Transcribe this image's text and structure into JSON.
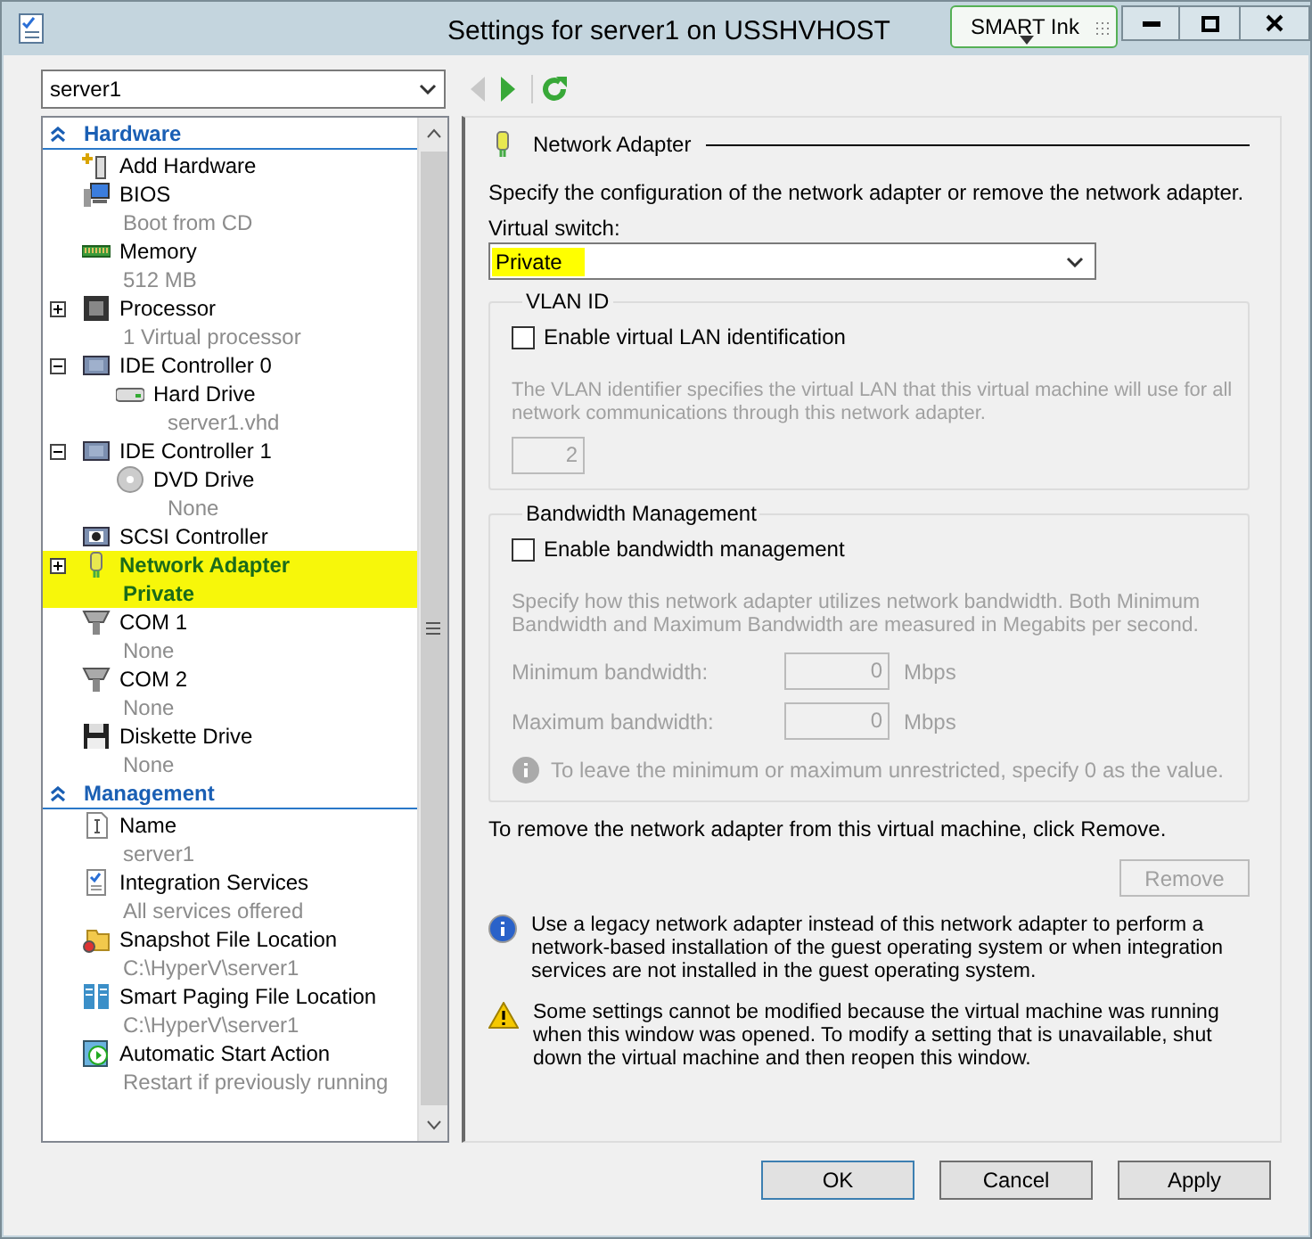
{
  "window": {
    "title": "Settings for server1 on USSHVHOST",
    "smart_ink": "SMART Ink"
  },
  "vm_selector": {
    "value": "server1"
  },
  "nav": [
    {
      "kind": "back",
      "disabled": true
    },
    {
      "kind": "forward",
      "disabled": false
    },
    {
      "kind": "refresh",
      "disabled": false
    }
  ],
  "tree": [
    {
      "title": "Hardware",
      "expanded": true,
      "items": [
        {
          "kind": "add",
          "label": "Add Hardware",
          "selected": false
        },
        {
          "kind": "bios",
          "label": "BIOS",
          "detail": "Boot from CD",
          "selected": false
        },
        {
          "kind": "memory",
          "label": "Memory",
          "detail": "512 MB",
          "selected": false
        },
        {
          "kind": "cpu",
          "label": "Processor",
          "detail": "1 Virtual processor",
          "expanded": false,
          "selected": false
        },
        {
          "kind": "controller",
          "label": "IDE Controller 0",
          "expanded": true,
          "selected": false,
          "children": [
            {
              "kind": "disk",
              "label": "Hard Drive",
              "detail": "server1.vhd",
              "selected": false
            }
          ]
        },
        {
          "kind": "controller",
          "label": "IDE Controller 1",
          "expanded": true,
          "selected": false,
          "children": [
            {
              "kind": "dvd",
              "label": "DVD Drive",
              "detail": "None",
              "selected": false
            }
          ]
        },
        {
          "kind": "scsi",
          "label": "SCSI Controller",
          "selected": false
        },
        {
          "kind": "network",
          "label": "Network Adapter",
          "detail": "Private",
          "expanded": false,
          "selected": true
        },
        {
          "kind": "com",
          "label": "COM 1",
          "detail": "None",
          "selected": false
        },
        {
          "kind": "com",
          "label": "COM 2",
          "detail": "None",
          "selected": false
        },
        {
          "kind": "floppy",
          "label": "Diskette Drive",
          "detail": "None",
          "selected": false
        }
      ]
    },
    {
      "title": "Management",
      "expanded": true,
      "items": [
        {
          "kind": "name",
          "label": "Name",
          "detail": "server1",
          "selected": false
        },
        {
          "kind": "integration",
          "label": "Integration Services",
          "detail": "All services offered",
          "selected": false
        },
        {
          "kind": "folder",
          "label": "Snapshot File Location",
          "detail": "C:\\HyperV\\server1",
          "selected": false
        },
        {
          "kind": "paging",
          "label": "Smart Paging File Location",
          "detail": "C:\\HyperV\\server1",
          "selected": false
        },
        {
          "kind": "start",
          "label": "Automatic Start Action",
          "detail": "Restart if previously running",
          "selected": false
        }
      ]
    }
  ],
  "settings": {
    "heading": "Network Adapter",
    "intro": "Specify the configuration of the network adapter or remove the network adapter.",
    "virtual_switch": {
      "label": "Virtual switch:",
      "value": "Private",
      "highlighted": true
    },
    "vlan": {
      "legend": "VLAN ID",
      "disabled": true,
      "checkbox": {
        "label": "Enable virtual LAN identification",
        "checked": false
      },
      "description": "The VLAN identifier specifies the virtual LAN that this virtual machine will use for all network communications through this network adapter.",
      "id_value": "2"
    },
    "bandwidth": {
      "legend": "Bandwidth Management",
      "disabled": true,
      "checkbox": {
        "label": "Enable bandwidth management",
        "checked": false
      },
      "description": "Specify how this network adapter utilizes network bandwidth. Both Minimum Bandwidth and Maximum Bandwidth are measured in Megabits per second.",
      "fields": [
        {
          "label": "Minimum bandwidth:",
          "value": "0",
          "unit": "Mbps"
        },
        {
          "label": "Maximum bandwidth:",
          "value": "0",
          "unit": "Mbps"
        }
      ],
      "note": "To leave the minimum or maximum unrestricted, specify 0 as the value."
    },
    "remove_text": "To remove the network adapter from this virtual machine, click Remove.",
    "remove_button": {
      "label": "Remove",
      "disabled": true
    },
    "messages": [
      {
        "kind": "info",
        "text": "Use a legacy network adapter instead of this network adapter to perform a network-based installation of the guest operating system or when integration services are not installed in the guest operating system."
      },
      {
        "kind": "warning",
        "text": "Some settings cannot be modified because the virtual machine was running when this window was opened. To modify a setting that is unavailable, shut down the virtual machine and then reopen this window."
      }
    ]
  },
  "buttons": [
    {
      "label": "OK",
      "default": true
    },
    {
      "label": "Cancel",
      "default": false
    },
    {
      "label": "Apply",
      "default": false
    }
  ]
}
